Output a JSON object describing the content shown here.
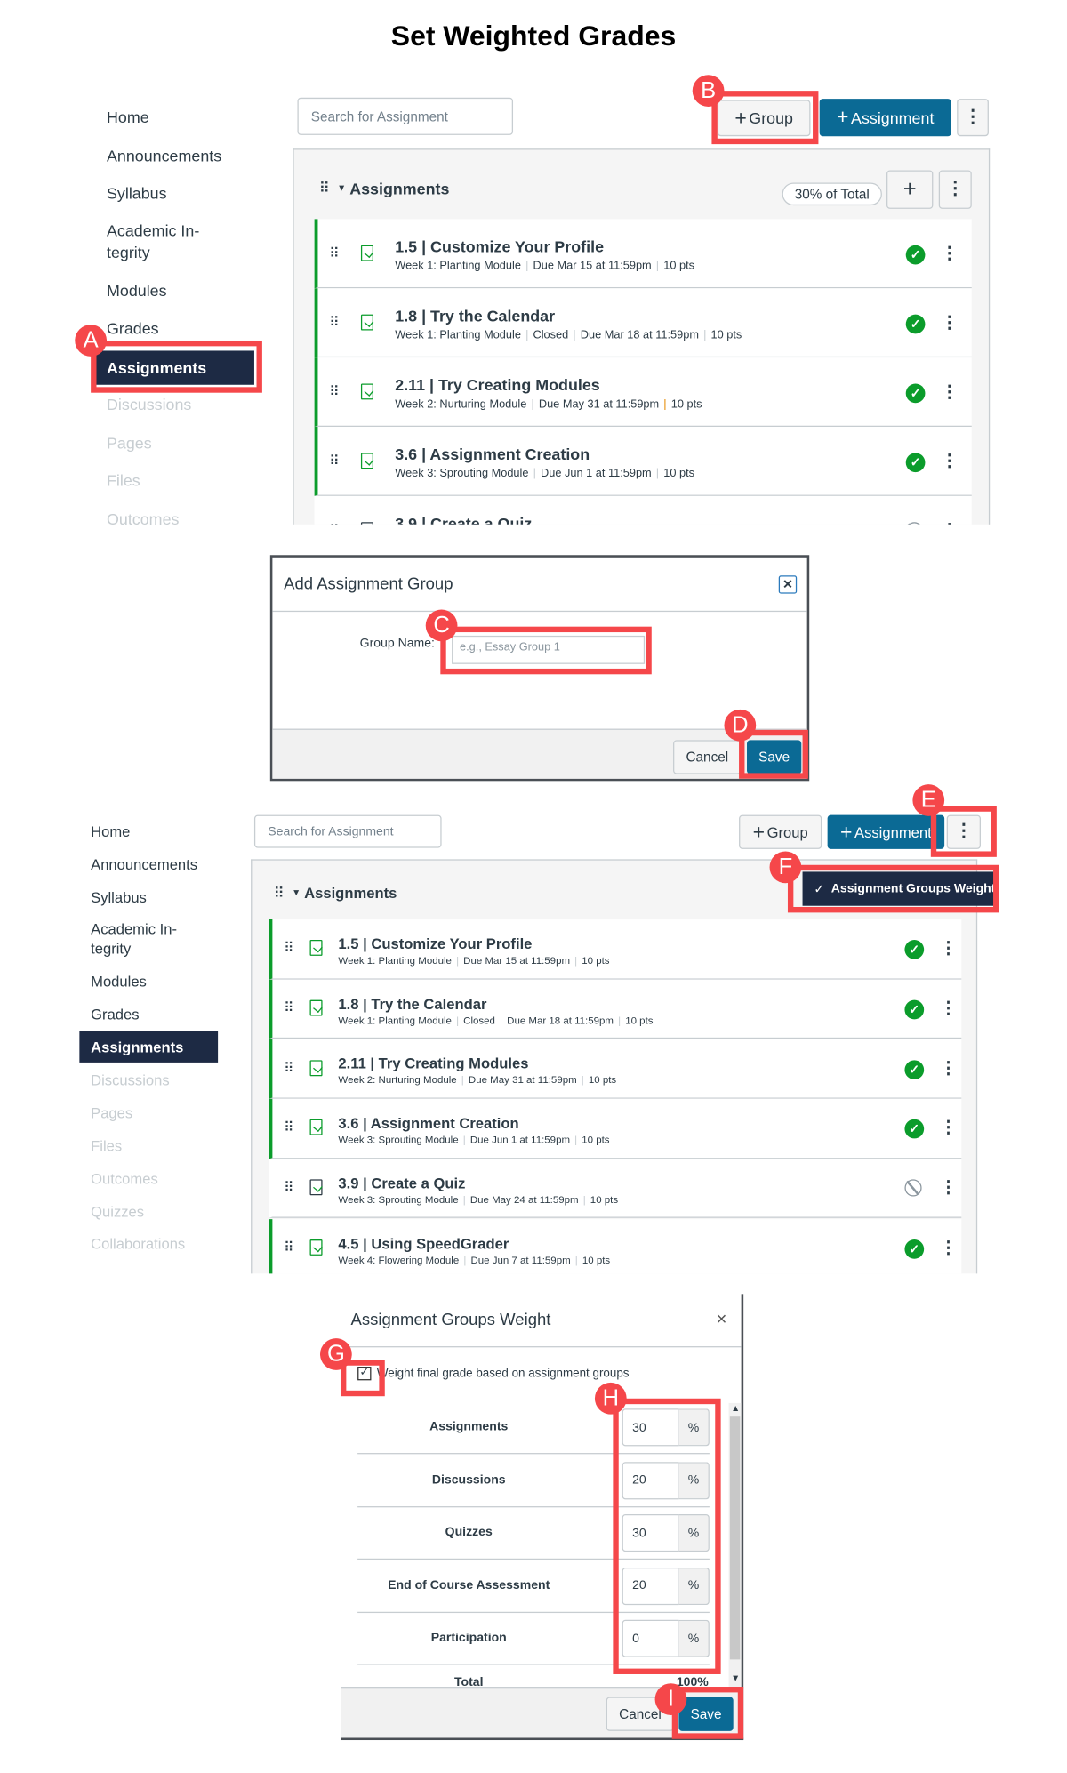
{
  "page_title": "Set Weighted Grades",
  "colors": {
    "brand_button": "#0b6a95",
    "nav_active": "#1d2a44",
    "published_green": "#0b9c2b",
    "callout_red": "#f5474a"
  },
  "sidebar": [
    "Home",
    "Announcements",
    "Syllabus",
    "Academic In-",
    "tegrity",
    "Modules",
    "Grades",
    "Assignments",
    "Discussions",
    "Pages",
    "Files",
    "Outcomes",
    "Quizzes",
    "Collaborations"
  ],
  "toolbar": {
    "search_placeholder": "Search for Assignment",
    "group_label": "Group",
    "assignment_label": "Assignment",
    "plus_icon": "+",
    "kebab_icon": "⋮"
  },
  "group": {
    "name": "Assignments",
    "weight": "30% of Total"
  },
  "assignments": [
    {
      "title": "1.5 | Customize Your Profile",
      "meta": [
        "Week 1: Planting Module",
        "Due Mar 15 at 11:59pm",
        "10 pts"
      ],
      "published": true
    },
    {
      "title": "1.8 | Try the Calendar",
      "meta": [
        "Week 1: Planting Module",
        "Closed",
        "Due Mar 18 at 11:59pm",
        "10 pts"
      ],
      "published": true
    },
    {
      "title": "2.11 | Try Creating Modules",
      "meta": [
        "Week 2: Nurturing Module",
        "Due May 31 at 11:59pm",
        "10 pts"
      ],
      "published": true
    },
    {
      "title": "3.6 | Assignment Creation",
      "meta": [
        "Week 3: Sprouting Module",
        "Due Jun 1 at 11:59pm",
        "10 pts"
      ],
      "published": true
    },
    {
      "title": "3.9 | Create a Quiz",
      "meta": [
        "Week 3: Sprouting Module",
        "Due May 24 at 11:59pm",
        "10 pts"
      ],
      "published": false
    },
    {
      "title": "4.5 | Using SpeedGrader",
      "meta": [
        "Week 4: Flowering Module",
        "Due Jun 7 at 11:59pm",
        "10 pts"
      ],
      "published": true
    }
  ],
  "add_group_dialog": {
    "title": "Add Assignment Group",
    "close": "×",
    "field_label": "Group Name:",
    "placeholder": "e.g., Essay Group 1",
    "cancel": "Cancel",
    "save": "Save"
  },
  "menu": {
    "item": "Assignment Groups Weight",
    "check": "✓"
  },
  "weight_dialog": {
    "title": "Assignment Groups Weight",
    "close": "×",
    "checkbox_label": "Weight final grade based on assignment groups",
    "checked": true,
    "groups": [
      {
        "name": "Assignments",
        "value": "30"
      },
      {
        "name": "Discussions",
        "value": "20"
      },
      {
        "name": "Quizzes",
        "value": "30"
      },
      {
        "name": "End of Course Assessment",
        "value": "20"
      },
      {
        "name": "Participation",
        "value": "0"
      }
    ],
    "unit": "%",
    "total_label": "Total",
    "total_value": "100%",
    "cancel": "Cancel",
    "save": "Save"
  },
  "callouts": [
    "A",
    "B",
    "C",
    "D",
    "E",
    "F",
    "G",
    "H",
    "I"
  ]
}
